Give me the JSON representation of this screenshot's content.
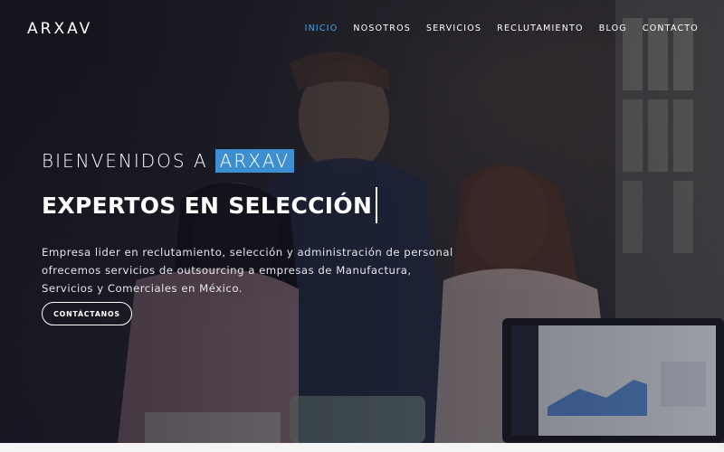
{
  "nav": {
    "logo": "ARXAV",
    "items": [
      {
        "label": "INICIO",
        "active": true
      },
      {
        "label": "NOSOTROS",
        "active": false
      },
      {
        "label": "SERVICIOS",
        "active": false
      },
      {
        "label": "RECLUTAMIENTO",
        "active": false
      },
      {
        "label": "BLOG",
        "active": false
      },
      {
        "label": "CONTACTO",
        "active": false
      }
    ]
  },
  "hero": {
    "welcome_prefix": "BIENVENIDOS A",
    "welcome_brand": "ARXAV",
    "headline_static": "EXPERTOS EN",
    "headline_typed": "SELECCIÓN",
    "description_lines": [
      "Empresa lider en reclutamiento, selección y administración de personal",
      "ofrecemos servicios de outsourcing a empresas de Manufactura,",
      "Servicios y Comerciales en México."
    ],
    "cta_label": "CONTÁCTANOS"
  },
  "colors": {
    "accent": "#3e8fd1",
    "active_nav": "#4aa3e0",
    "overlay": "#0c0e1a"
  }
}
